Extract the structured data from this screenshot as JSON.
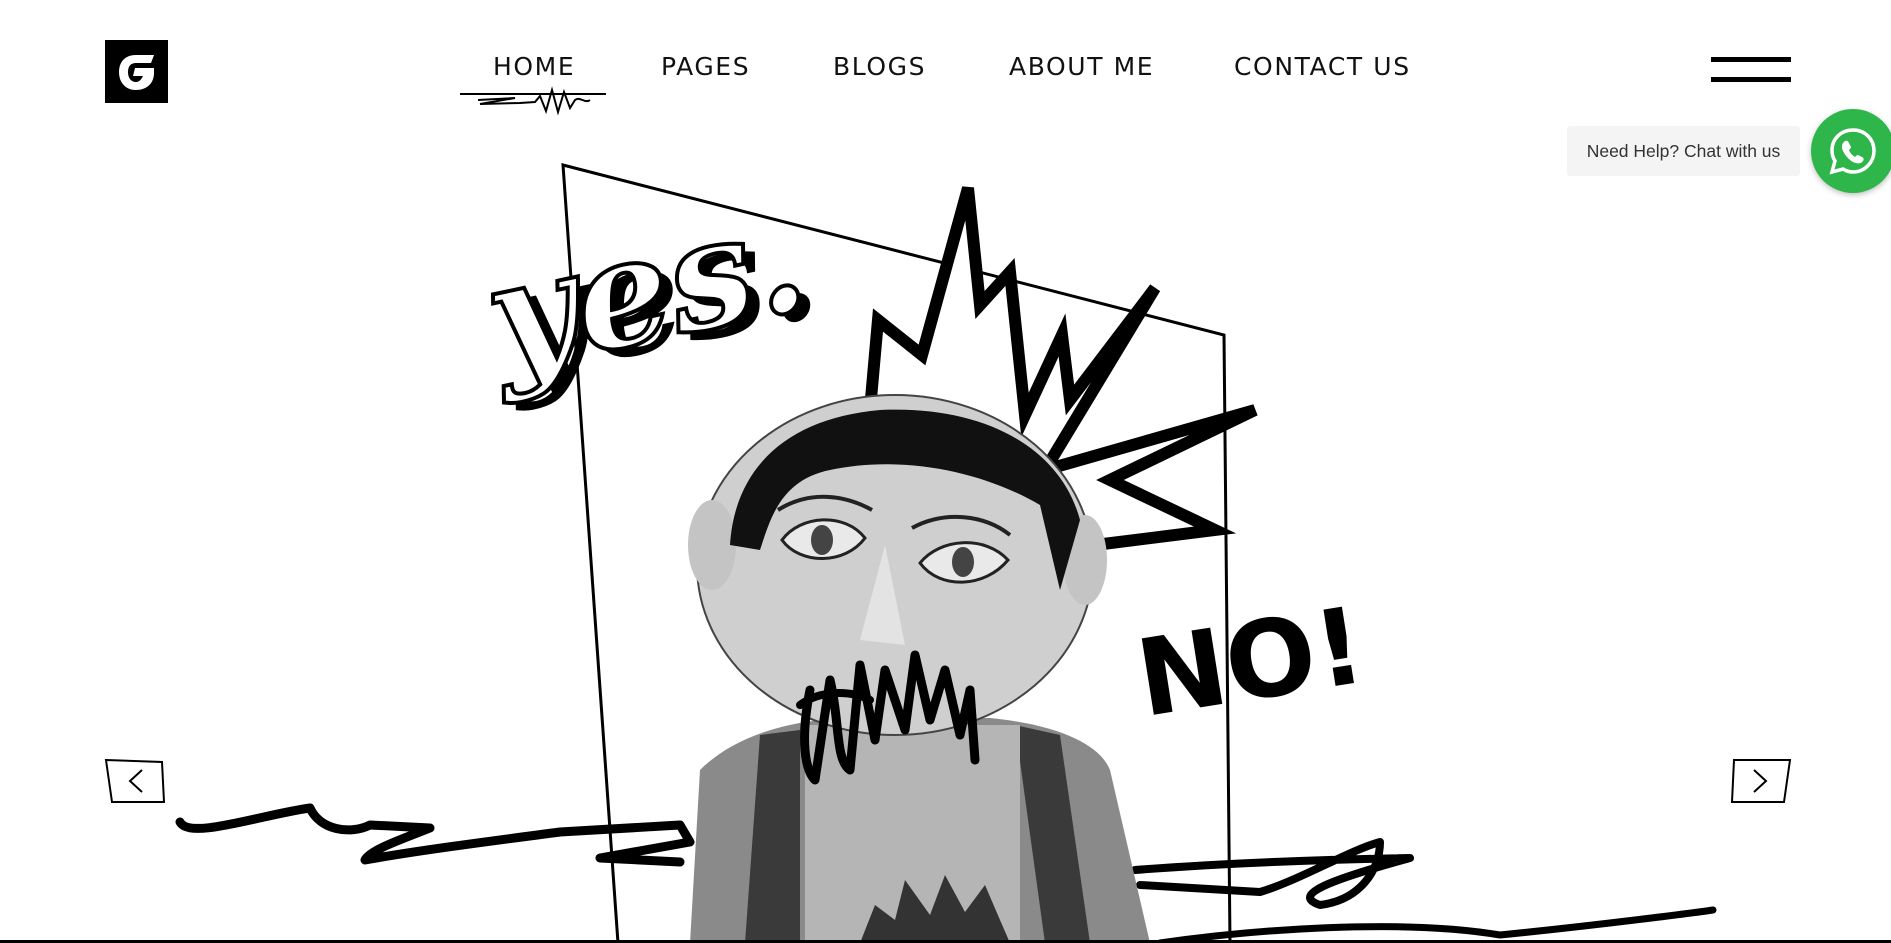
{
  "header": {
    "logo_letter": "G",
    "nav": [
      {
        "label": "HOME",
        "active": true
      },
      {
        "label": "PAGES",
        "active": false
      },
      {
        "label": "BLOGS",
        "active": false
      },
      {
        "label": "ABOUT ME",
        "active": false
      },
      {
        "label": "CONTACT US",
        "active": false
      }
    ],
    "menu_icon": "hamburger-icon"
  },
  "hero": {
    "yes_text": "yes.",
    "no_text": "NO!",
    "image_subject": "papier-mache head figure in t-shirt"
  },
  "slider": {
    "prev_icon": "chevron-left-icon",
    "next_icon": "chevron-right-icon"
  },
  "chat": {
    "help_text": "Need Help? Chat with us",
    "button_icon": "whatsapp-icon",
    "button_color": "#2eb64a"
  }
}
